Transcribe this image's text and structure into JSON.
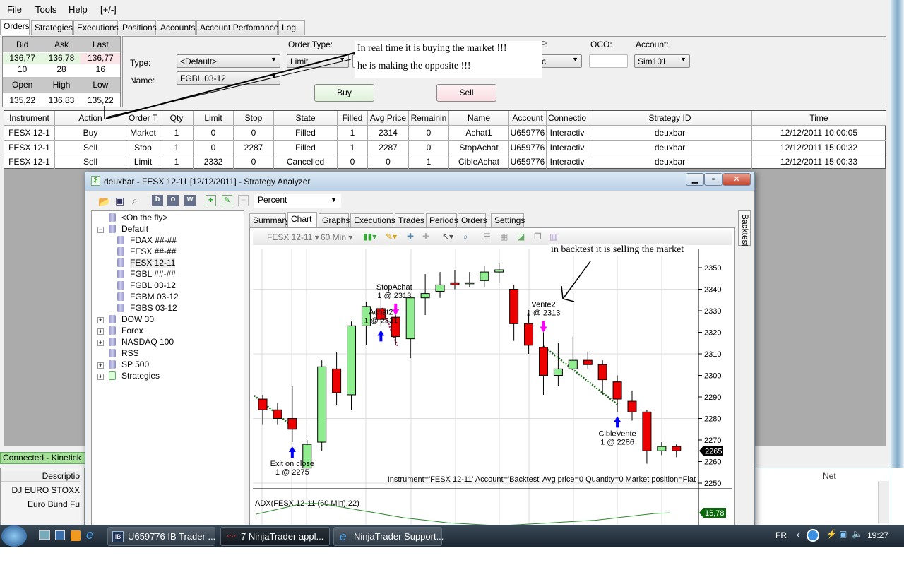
{
  "menu": [
    "File",
    "Tools",
    "Help",
    "[+/-]"
  ],
  "tabs": [
    "Orders",
    "Strategies",
    "Executions",
    "Positions",
    "Accounts",
    "Account Perfomance",
    "Log"
  ],
  "quote": {
    "h1": [
      "Bid",
      "Ask",
      "Last"
    ],
    "v1": [
      "136,77",
      "136,78",
      "136,77"
    ],
    "s1": [
      "10",
      "28",
      "16"
    ],
    "h2": [
      "Open",
      "High",
      "Low"
    ],
    "v2": [
      "135,22",
      "136,83",
      "135,22"
    ]
  },
  "entry": {
    "type_label": "Type:",
    "name_label": "Name:",
    "type_value": "<Default>",
    "name_value": "FGBL 03-12",
    "order_type_label": "Order Type:",
    "order_type_value": "Limit",
    "qty_partial": "1",
    "tif_label": "F:",
    "tif_partial": "c",
    "oco_label": "OCO:",
    "oco_value": "",
    "account_label": "Account:",
    "account_value": "Sim101",
    "buy": "Buy",
    "sell": "Sell"
  },
  "orders": {
    "columns": [
      "Instrument",
      "Action",
      "Order T",
      "Qty",
      "Limit",
      "Stop",
      "State",
      "Filled",
      "Avg Price",
      "Remainin",
      "Name",
      "Account",
      "Connectio",
      "Strategy ID",
      "Time"
    ],
    "rows": [
      [
        "FESX 12-1",
        "Buy",
        "Market",
        "1",
        "0",
        "0",
        "Filled",
        "1",
        "2314",
        "0",
        "Achat1",
        "U659776",
        "Interactiv",
        "deuxbar",
        "12/12/2011 10:00:05"
      ],
      [
        "FESX 12-1",
        "Sell",
        "Stop",
        "1",
        "0",
        "2287",
        "Filled",
        "1",
        "2287",
        "0",
        "StopAchat",
        "U659776",
        "Interactiv",
        "deuxbar",
        "12/12/2011 15:00:32"
      ],
      [
        "FESX 12-1",
        "Sell",
        "Limit",
        "1",
        "2332",
        "0",
        "Cancelled",
        "0",
        "0",
        "1",
        "CibleAchat",
        "U659776",
        "Interactiv",
        "deuxbar",
        "12/12/2011 15:00:33"
      ]
    ]
  },
  "status": "Connected - Kinetick",
  "behind_left": {
    "header": "Descriptio",
    "rows": [
      "DJ EURO STOXX",
      "Euro Bund Fu"
    ]
  },
  "behind_right": {
    "header": "Net"
  },
  "annotations": {
    "top": [
      "In real time it is buying the market !!!",
      "he is making the opposite !!!"
    ],
    "backtest": "in backtest it is selling the market"
  },
  "analyzer": {
    "title": "deuxbar - FESX 12-11 [12/12/2011] - Strategy Analyzer",
    "display_select": "Percent",
    "tree": [
      {
        "label": "<On the fly>",
        "level": 1,
        "expander": ""
      },
      {
        "label": "Default",
        "level": 0,
        "expander": "−"
      },
      {
        "label": "FDAX ##-##",
        "level": 2
      },
      {
        "label": "FESX ##-##",
        "level": 2
      },
      {
        "label": "FESX 12-11",
        "level": 2
      },
      {
        "label": "FGBL ##-##",
        "level": 2
      },
      {
        "label": "FGBL 03-12",
        "level": 2
      },
      {
        "label": "FGBM 03-12",
        "level": 2
      },
      {
        "label": "FGBS 03-12",
        "level": 2
      },
      {
        "label": "DOW 30",
        "level": 0,
        "expander": "+"
      },
      {
        "label": "Forex",
        "level": 0,
        "expander": "+"
      },
      {
        "label": "NASDAQ 100",
        "level": 0,
        "expander": "+"
      },
      {
        "label": "RSS",
        "level": 0,
        "expander": ""
      },
      {
        "label": "SP 500",
        "level": 0,
        "expander": "+"
      },
      {
        "label": "Strategies",
        "level": 0,
        "expander": "+"
      }
    ],
    "tabs": [
      "Summary",
      "Chart",
      "Graphs",
      "Executions",
      "Trades",
      "Periods",
      "Orders",
      "Settings"
    ],
    "active_tab": "Chart",
    "side_tab": "Backtest",
    "chart_instrument": "FESX 12-11",
    "chart_period": "60 Min",
    "info": "Instrument='FESX 12-11' Account='Backtest' Avg price=0 Quantity=0 Market position=Flat",
    "indicator_label": "ADX(FESX 12-11 (60 Min),22)",
    "indicator_value": "15,78",
    "last_price": "2265"
  },
  "chart_data": {
    "type": "candlestick",
    "yticks": [
      2350,
      2340,
      2330,
      2320,
      2310,
      2300,
      2290,
      2280,
      2270,
      2260,
      2250
    ],
    "ylim": [
      2247,
      2355
    ],
    "candles": [
      [
        2289,
        2291,
        2277,
        2284
      ],
      [
        2284,
        2287,
        2277,
        2280
      ],
      [
        2280,
        2295,
        2269,
        2275
      ],
      [
        2257,
        2270,
        2257,
        2268
      ],
      [
        2269,
        2307,
        2265,
        2304
      ],
      [
        2303,
        2311,
        2286,
        2292
      ],
      [
        2291,
        2325,
        2284,
        2323
      ],
      [
        2323,
        2334,
        2314,
        2332
      ],
      [
        2331,
        2336,
        2323,
        2326
      ],
      [
        2327,
        2328,
        2314,
        2318
      ],
      [
        2317,
        2336,
        2308,
        2336
      ],
      [
        2336,
        2347,
        2328,
        2338
      ],
      [
        2339,
        2348,
        2336,
        2342
      ],
      [
        2343,
        2349,
        2340,
        2342
      ],
      [
        2343,
        2348,
        2341,
        2343
      ],
      [
        2344,
        2351,
        2341,
        2348
      ],
      [
        2348,
        2352,
        2343,
        2349
      ],
      [
        2340,
        2342,
        2316,
        2324
      ],
      [
        2324,
        2329,
        2310,
        2314
      ],
      [
        2313,
        2320,
        2291,
        2300
      ],
      [
        2300,
        2315,
        2295,
        2303
      ],
      [
        2303,
        2318,
        2303,
        2307
      ],
      [
        2307,
        2311,
        2303,
        2305
      ],
      [
        2305,
        2307,
        2291,
        2298
      ],
      [
        2297,
        2300,
        2283,
        2289
      ],
      [
        2288,
        2293,
        2279,
        2283
      ],
      [
        2283,
        2284,
        2259,
        2265
      ],
      [
        2265,
        2269,
        2263,
        2267
      ],
      [
        2267,
        2268,
        2262,
        2265
      ]
    ],
    "markers": [
      {
        "bar": 2,
        "side": "buy",
        "lines": [
          "Exit on close",
          "1 @ 2275"
        ]
      },
      {
        "bar": 8,
        "side": "buy",
        "lines": [
          "Achat2",
          "1 @ 2331"
        ]
      },
      {
        "bar": 9,
        "side": "sell",
        "lines": [
          "StopAchat",
          "1 @ 2313"
        ]
      },
      {
        "bar": 19,
        "side": "sell",
        "lines": [
          "Vente2",
          "1 @ 2313"
        ]
      },
      {
        "bar": 24,
        "side": "buy",
        "lines": [
          "CibleVente",
          "1 @ 2286"
        ]
      }
    ],
    "adx": [
      14,
      18,
      22,
      26,
      27,
      25,
      22,
      19,
      16,
      13,
      10,
      8,
      6,
      4,
      3,
      2,
      1,
      1,
      2,
      3,
      4,
      5,
      6,
      7,
      9,
      11,
      13,
      15,
      15.78
    ]
  },
  "taskbar": {
    "buttons": [
      "U659776 IB Trader ...",
      "7 NinjaTrader appl...",
      "NinjaTrader Support..."
    ],
    "lang": "FR",
    "time": "19:27"
  }
}
